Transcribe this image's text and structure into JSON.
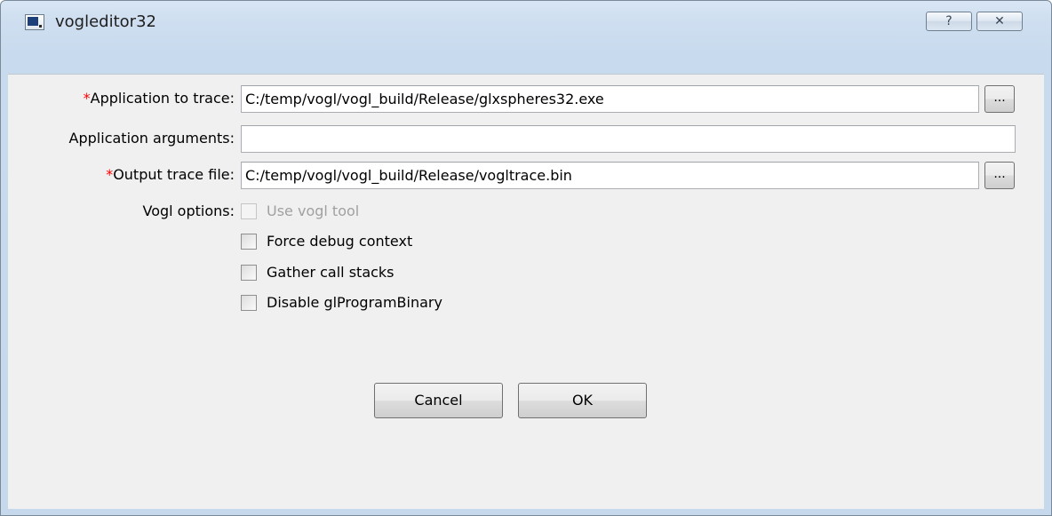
{
  "window": {
    "title": "vogleditor32",
    "help_label": "?",
    "close_label": "✕"
  },
  "form": {
    "app_trace": {
      "required_mark": "*",
      "label": "Application to trace:",
      "value": "C:/temp/vogl/vogl_build/Release/glxspheres32.exe",
      "browse_label": "..."
    },
    "app_args": {
      "label": "Application arguments:",
      "value": ""
    },
    "output_trace": {
      "required_mark": "*",
      "label": "Output trace file:",
      "value": "C:/temp/vogl/vogl_build/Release/vogltrace.bin",
      "browse_label": "..."
    },
    "vogl_options": {
      "label": "Vogl options:",
      "items": [
        {
          "label": "Use vogl tool",
          "checked": false,
          "enabled": false
        },
        {
          "label": "Force debug context",
          "checked": false,
          "enabled": true
        },
        {
          "label": "Gather call stacks",
          "checked": false,
          "enabled": true
        },
        {
          "label": "Disable glProgramBinary",
          "checked": false,
          "enabled": true
        }
      ]
    }
  },
  "buttons": {
    "cancel_label": "Cancel",
    "ok_label": "OK"
  },
  "colors": {
    "required_marker": "#ff0000",
    "disabled_text": "#a0a0a0",
    "client_bg": "#f0f0f0"
  },
  "icons": {
    "app": "app-window-icon",
    "help": "help-icon",
    "close": "close-icon"
  }
}
